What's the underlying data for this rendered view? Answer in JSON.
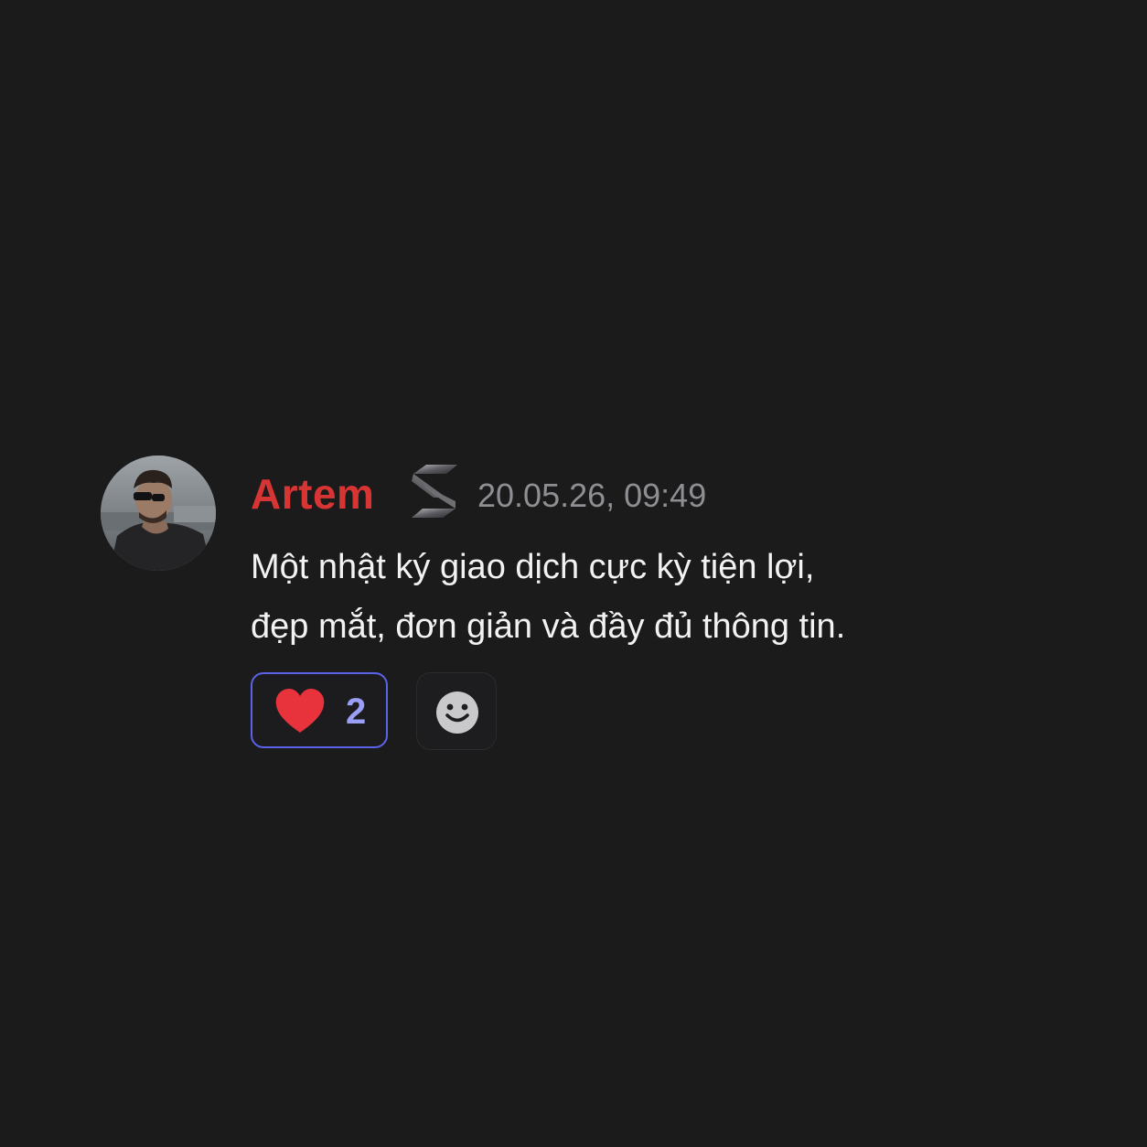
{
  "comment": {
    "author": "Artem",
    "timestamp": "20.05.26, 09:49",
    "message_lines": [
      "Một nhật ký giao dịch cực kỳ tiện lợi,",
      "đẹp mắt, đơn giản và đầy đủ thông tin."
    ],
    "avatar_icon": "user-avatar-photo",
    "badge_icon": "s-logo-badge"
  },
  "reactions": [
    {
      "emoji_icon": "heart-icon",
      "count": "2",
      "selected": true
    }
  ],
  "add_reaction": {
    "icon": "smiley-icon"
  },
  "colors": {
    "background": "#1b1b1c",
    "author": "#d63534",
    "timestamp": "#8e8e93",
    "message": "#f2f2f2",
    "reaction_border": "#5b63ea",
    "reaction_count": "#9aa0f5",
    "heart": "#e8333c"
  }
}
